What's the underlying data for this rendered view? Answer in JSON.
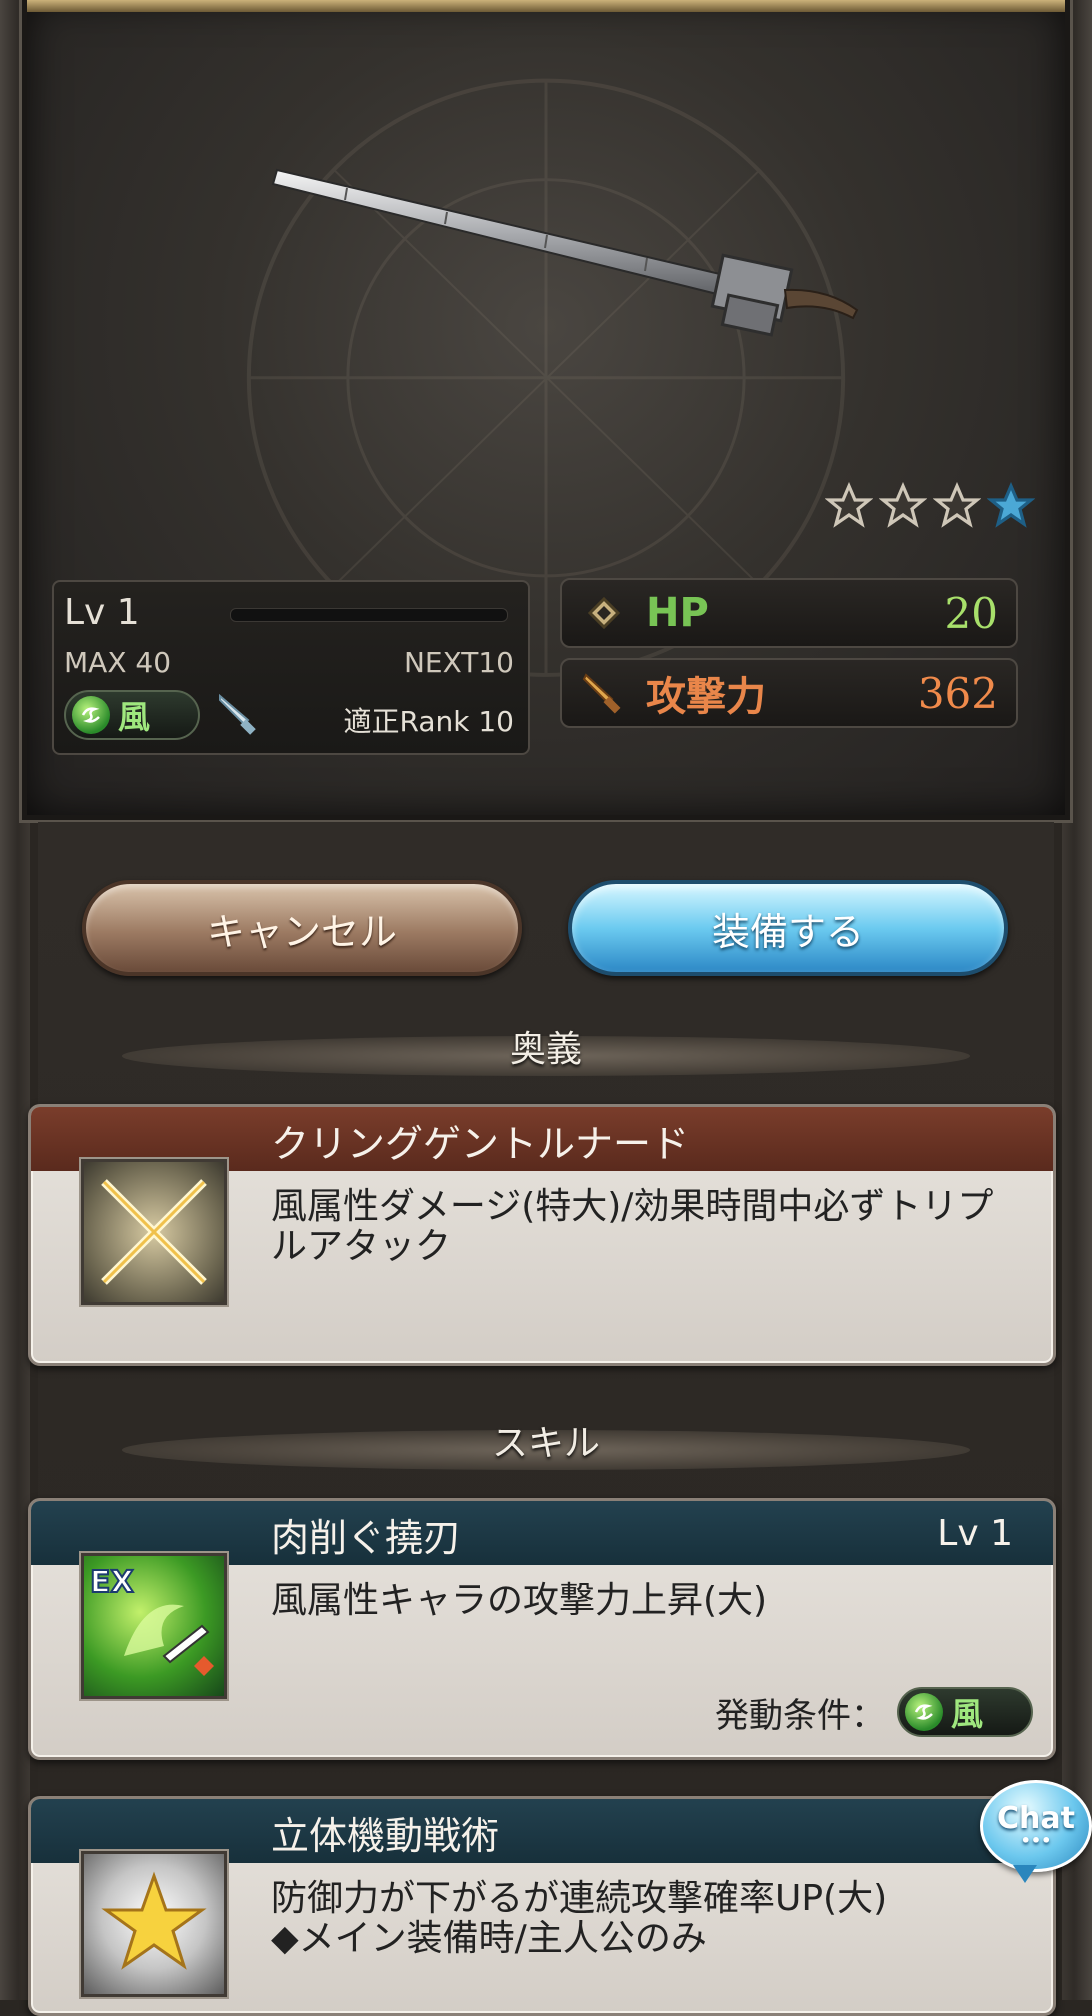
{
  "weapon": {
    "rarity_stars": 4,
    "rarity_filled": 1
  },
  "info": {
    "lv_label": "Lv 1",
    "max_label": "MAX 40",
    "next_label": "NEXT10",
    "element_label": "風",
    "rank_label": "適正Rank 10"
  },
  "stats": {
    "hp_label": "HP",
    "hp_value": "20",
    "atk_label": "攻撃力",
    "atk_value": "362"
  },
  "buttons": {
    "cancel_label": "キャンセル",
    "equip_label": "装備する"
  },
  "sections": {
    "ougi_header": "奥義",
    "skill_header": "スキル"
  },
  "ougi": {
    "title": "クリングゲントルナード",
    "desc": "風属性ダメージ(特大)/効果時間中必ずトリプルアタック"
  },
  "skill1": {
    "title": "肉削ぐ撓刃",
    "lv": "Lv 1",
    "desc": "風属性キャラの攻撃力上昇(大)",
    "cond_label": "発動条件：",
    "cond_element": "風"
  },
  "skill2": {
    "title": "立体機動戦術",
    "desc_line1": "防御力が下がるが連続攻撃確率UP(大)",
    "desc_line2": "◆メイン装備時/主人公のみ"
  },
  "chat": {
    "label": "Chat",
    "dots": "•••"
  },
  "colors": {
    "hp_green": "#78c455",
    "atk_orange": "#e9864a",
    "wind_green": "#9fe77e",
    "equip_blue": "#6ccbf0"
  }
}
